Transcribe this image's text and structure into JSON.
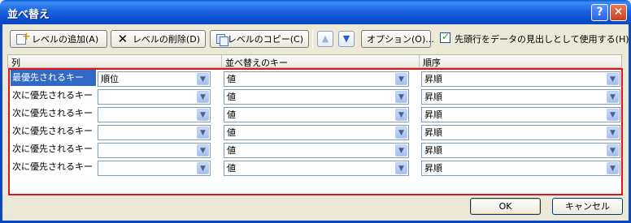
{
  "window": {
    "title": "並べ替え",
    "help_glyph": "?",
    "close_glyph": "✕"
  },
  "toolbar": {
    "add_level": "レベルの追加(A)",
    "delete_level": "レベルの削除(D)",
    "copy_level": "レベルのコピー(C)",
    "move_up_glyph": "▲",
    "move_down_glyph": "▼",
    "options": "オプション(O)...",
    "header_checkbox_label": "先頭行をデータの見出しとして使用する(H)",
    "header_checkbox_checked": true
  },
  "columns": {
    "column": "列",
    "sort_on": "並べ替えのキー",
    "order": "順序"
  },
  "rows": [
    {
      "label": "最優先されるキー",
      "column": "順位",
      "sort_on": "値",
      "order": "昇順",
      "selected": true
    },
    {
      "label": "次に優先されるキー",
      "column": "",
      "sort_on": "値",
      "order": "昇順",
      "selected": false
    },
    {
      "label": "次に優先されるキー",
      "column": "",
      "sort_on": "値",
      "order": "昇順",
      "selected": false
    },
    {
      "label": "次に優先されるキー",
      "column": "",
      "sort_on": "値",
      "order": "昇順",
      "selected": false
    },
    {
      "label": "次に優先されるキー",
      "column": "",
      "sort_on": "値",
      "order": "昇順",
      "selected": false
    },
    {
      "label": "次に優先されるキー",
      "column": "",
      "sort_on": "値",
      "order": "昇順",
      "selected": false
    }
  ],
  "icons": {
    "dropdown_glyph": "▼",
    "delete_glyph": "✕"
  },
  "footer": {
    "ok": "OK",
    "cancel": "キャンセル"
  },
  "colors": {
    "titlebar": "#0a4fcf",
    "selection": "#316ac5",
    "highlight_border": "#e0141c"
  }
}
